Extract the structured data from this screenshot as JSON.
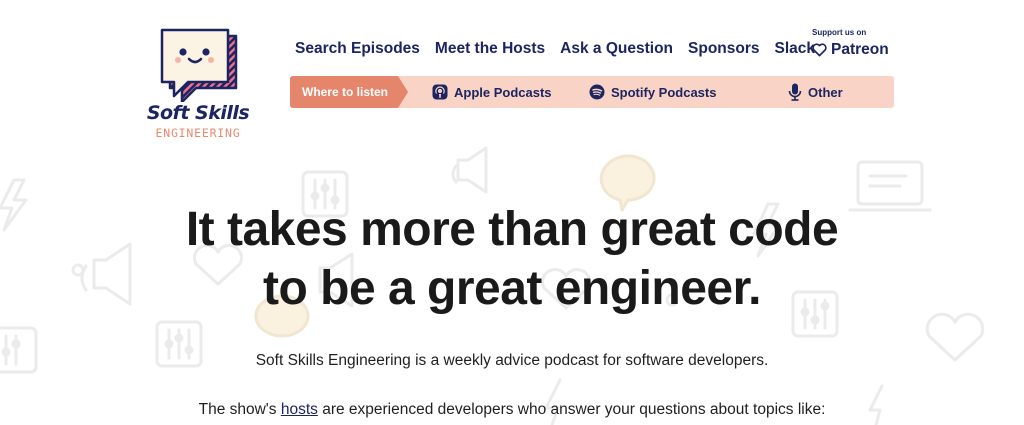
{
  "logo": {
    "title": "Soft Skills",
    "subtitle": "ENGINEERING",
    "icon": "speech-bubble-face-icon"
  },
  "nav": {
    "items": [
      {
        "label": "Search Episodes"
      },
      {
        "label": "Meet the Hosts"
      },
      {
        "label": "Ask a Question"
      },
      {
        "label": "Sponsors"
      },
      {
        "label": "Slack"
      }
    ],
    "support_label": "Support us on",
    "patreon_label": "Patreon",
    "patreon_icon": "heart-icon"
  },
  "listen": {
    "tag": "Where to listen",
    "items": [
      {
        "label": "Apple Podcasts",
        "icon": "apple-podcasts-icon"
      },
      {
        "label": "Spotify Podcasts",
        "icon": "spotify-icon"
      },
      {
        "label": "Other",
        "icon": "microphone-icon"
      }
    ]
  },
  "hero": {
    "headline_line1": "It takes more than great code",
    "headline_line2": "to be a great engineer.",
    "tagline": "Soft Skills Engineering is a weekly advice podcast for software developers.",
    "hosts_prefix": "The show's ",
    "hosts_link": "hosts",
    "hosts_suffix": " are experienced developers who answer your questions about topics like:"
  },
  "colors": {
    "navy": "#1c2561",
    "accent": "#e5866c",
    "listen_bar": "#f9d3c5",
    "logo_pink": "#f06f8b",
    "logo_cream": "#fbf3e4"
  }
}
